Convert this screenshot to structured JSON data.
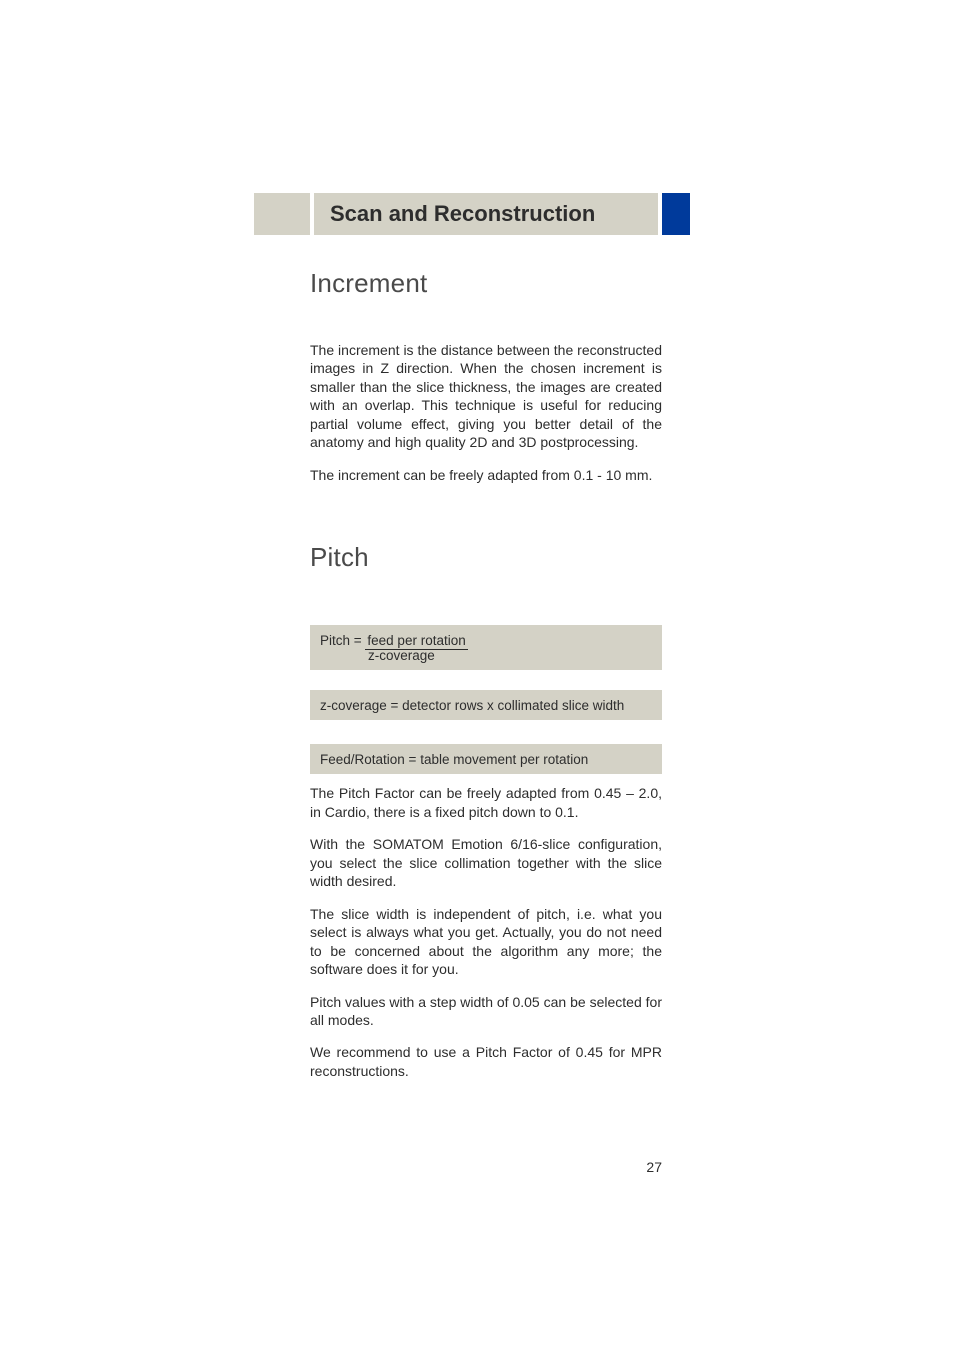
{
  "header": {
    "title": "Scan and Reconstruction"
  },
  "increment": {
    "heading": "Increment",
    "p1": "The increment is the distance between the reconstructed images in Z direction. When the chosen increment is smaller than the slice thickness, the images are created with an overlap. This technique is useful for reducing partial volume effect, giving you better detail of the anatomy and high quality 2D and 3D postprocessing.",
    "p2": "The increment can be freely adapted from 0.1 - 10 mm."
  },
  "pitch": {
    "heading": "Pitch",
    "formula_label": "Pitch = ",
    "formula_top": " feed per rotation ",
    "formula_bot": "z-coverage",
    "zcov": "z-coverage = detector rows x collimated slice width",
    "feedrot": "Feed/Rotation = table movement per rotation",
    "p1": "The Pitch Factor can be freely adapted from 0.45 – 2.0, in Cardio, there is a fixed pitch down to 0.1.",
    "p2": "With the SOMATOM Emotion 6/16-slice configuration, you select the slice collimation together with the slice width desired.",
    "p3": "The slice width is independent of pitch, i.e. what you select is always what you get. Actually, you do not need to be concerned about the algorithm any more; the software does it for you.",
    "p4": "Pitch values with a step width of 0.05 can be selected for all modes.",
    "p5": "We recommend to use a Pitch Factor of 0.45 for MPR reconstructions."
  },
  "page_number": "27"
}
